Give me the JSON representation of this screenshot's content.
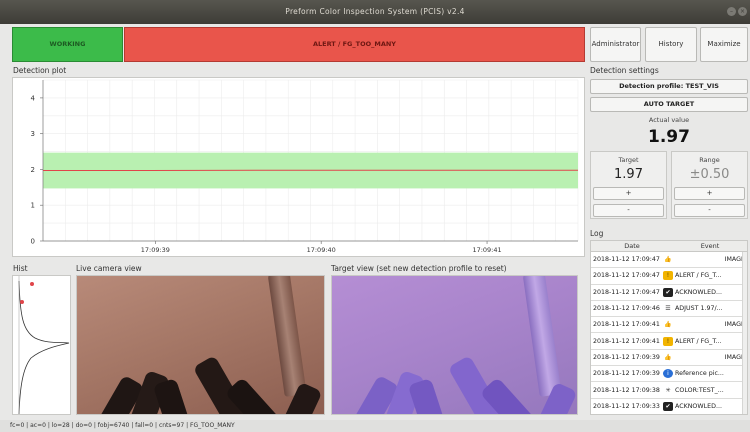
{
  "window": {
    "title": "Preform Color Inspection System (PCIS) v2.4"
  },
  "status": {
    "working_label": "WORKING",
    "alert_label": "ALERT / FG_TOO_MANY",
    "colors": {
      "working": "#3cbb4a",
      "alert": "#e9554b"
    }
  },
  "top_buttons": {
    "administrator": "Administrator",
    "history": "History",
    "maximize": "Maximize"
  },
  "plot": {
    "label": "Detection plot"
  },
  "chart_data": {
    "type": "line",
    "title": "",
    "xlabel": "",
    "ylabel": "",
    "x_ticks": [
      "17:09:39",
      "17:09:40",
      "17:09:41"
    ],
    "y_ticks": [
      0,
      1,
      2,
      3,
      4
    ],
    "ylim": [
      0,
      4.5
    ],
    "band": {
      "low": 1.47,
      "high": 2.47,
      "color": "#b9f0b1"
    },
    "series": [
      {
        "values": [
          1.97,
          1.97,
          1.98,
          1.98,
          1.98,
          1.98
        ],
        "color": "#e0454a"
      }
    ],
    "grid": true
  },
  "hist": {
    "label": "Hist"
  },
  "live": {
    "label": "Live camera view"
  },
  "target_view": {
    "label": "Target view (set new detection profile to reset)"
  },
  "settings": {
    "label": "Detection settings",
    "profile_button": "Detection profile: TEST_VIS",
    "auto_target_button": "AUTO TARGET",
    "actual_label": "Actual value",
    "actual_value": "1.97",
    "target_label": "Target",
    "target_value": "1.97",
    "range_label": "Range",
    "range_value": "±0.50",
    "plus": "+",
    "minus": "-"
  },
  "log": {
    "label": "Log",
    "col_date": "Date",
    "col_event": "Event",
    "rows": [
      {
        "date": "2018-11-12 17:09:47",
        "icon": "thumbs-up-icon",
        "glyph": "👍",
        "event": "IMAGE",
        "right": true
      },
      {
        "date": "2018-11-12 17:09:47",
        "icon": "alert-icon",
        "glyph": "!",
        "event": "ALERT / FG_T..."
      },
      {
        "date": "2018-11-12 17:09:47",
        "icon": "acknowledge-icon",
        "glyph": "✔",
        "event": "ACKNOWLED..."
      },
      {
        "date": "2018-11-12 17:09:46",
        "icon": "adjust-icon",
        "glyph": "☰",
        "event": "ADJUST 1.97/..."
      },
      {
        "date": "2018-11-12 17:09:41",
        "icon": "thumbs-up-icon",
        "glyph": "👍",
        "event": "IMAGE",
        "right": true
      },
      {
        "date": "2018-11-12 17:09:41",
        "icon": "alert-icon",
        "glyph": "!",
        "event": "ALERT / FG_T..."
      },
      {
        "date": "2018-11-12 17:09:39",
        "icon": "thumbs-up-icon",
        "glyph": "👍",
        "event": "IMAGE",
        "right": true
      },
      {
        "date": "2018-11-12 17:09:39",
        "icon": "info-icon",
        "glyph": "i",
        "event": "Reference pic..."
      },
      {
        "date": "2018-11-12 17:09:38",
        "icon": "color-icon",
        "glyph": "✳",
        "event": "COLOR:TEST_..."
      },
      {
        "date": "2018-11-12 17:09:33",
        "icon": "acknowledge-icon",
        "glyph": "✔",
        "event": "ACKNOWLED..."
      }
    ]
  },
  "statusbar": {
    "text": "fc=0 | ac=0 | lo=28 | do=0 | fobj=6740 | fall=0 | cnts=97 | FG_TOO_MANY"
  }
}
